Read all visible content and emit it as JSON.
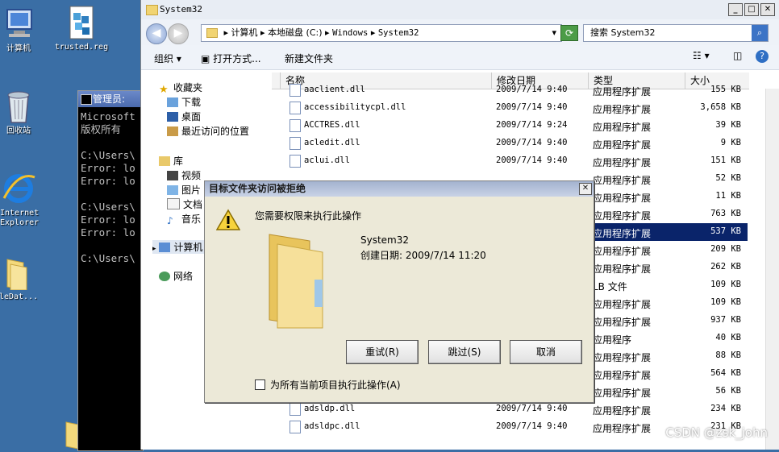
{
  "desktop": {
    "icons": [
      {
        "label": "计算机"
      },
      {
        "label": "trusted.reg"
      },
      {
        "label": "回收站"
      },
      {
        "label": "Internet\nExplorer"
      },
      {
        "label": "acleDat..."
      }
    ]
  },
  "console": {
    "title": "管理员:",
    "lines": "Microsoft\n版权所有\n\nC:\\Users\\\nError: lo\nError: lo\n\nC:\\Users\\\nError: lo\nError: lo\n\nC:\\Users\\"
  },
  "explorer": {
    "title": "System32",
    "address": {
      "parts": [
        "计算机",
        "本地磁盘 (C:)",
        "Windows",
        "System32"
      ],
      "sep": "▸"
    },
    "search_placeholder": "搜索 System32",
    "toolbar": {
      "organize": "组织",
      "open_with": "打开方式...",
      "new_folder": "新建文件夹"
    },
    "nav": {
      "favorites": "收藏夹",
      "downloads": "下载",
      "desktop": "桌面",
      "recent": "最近访问的位置",
      "libraries": "库",
      "videos": "视频",
      "pictures": "图片",
      "documents": "文档",
      "music": "音乐",
      "computer": "计算机",
      "network": "网络"
    },
    "columns": {
      "name": "名称",
      "date": "修改日期",
      "type": "类型",
      "size": "大小"
    },
    "files": [
      {
        "name": "aaclient.dll",
        "date": "2009/7/14 9:40",
        "type": "应用程序扩展",
        "size": "155 KB"
      },
      {
        "name": "accessibilitycpl.dll",
        "date": "2009/7/14 9:40",
        "type": "应用程序扩展",
        "size": "3,658 KB"
      },
      {
        "name": "ACCTRES.dll",
        "date": "2009/7/14 9:24",
        "type": "应用程序扩展",
        "size": "39 KB"
      },
      {
        "name": "acledit.dll",
        "date": "2009/7/14 9:40",
        "type": "应用程序扩展",
        "size": "9 KB"
      },
      {
        "name": "aclui.dll",
        "date": "2009/7/14 9:40",
        "type": "应用程序扩展",
        "size": "151 KB"
      },
      {
        "name": "",
        "date": "",
        "type": "应用程序扩展",
        "size": "52 KB"
      },
      {
        "name": "",
        "date": "",
        "type": "应用程序扩展",
        "size": "11 KB"
      },
      {
        "name": "",
        "date": "",
        "type": "应用程序扩展",
        "size": "763 KB"
      },
      {
        "name": "",
        "date": "",
        "type": "应用程序扩展",
        "size": "537 KB"
      },
      {
        "name": "",
        "date": "",
        "type": "应用程序扩展",
        "size": "209 KB"
      },
      {
        "name": "",
        "date": "",
        "type": "应用程序扩展",
        "size": "262 KB"
      },
      {
        "name": "",
        "date": "",
        "type": "LB 文件",
        "size": "109 KB"
      },
      {
        "name": "",
        "date": "",
        "type": "应用程序扩展",
        "size": "109 KB"
      },
      {
        "name": "",
        "date": "",
        "type": "应用程序扩展",
        "size": "937 KB"
      },
      {
        "name": "",
        "date": "",
        "type": "应用程序",
        "size": "40 KB"
      },
      {
        "name": "",
        "date": "",
        "type": "应用程序扩展",
        "size": "88 KB"
      },
      {
        "name": "",
        "date": "",
        "type": "应用程序扩展",
        "size": "564 KB"
      },
      {
        "name": "",
        "date": "",
        "type": "应用程序扩展",
        "size": "56 KB"
      },
      {
        "name": "adsldp.dll",
        "date": "2009/7/14 9:40",
        "type": "应用程序扩展",
        "size": "234 KB"
      },
      {
        "name": "adsldpc.dll",
        "date": "2009/7/14 9:40",
        "type": "应用程序扩展",
        "size": "231 KB"
      }
    ]
  },
  "dialog": {
    "title": "目标文件夹访问被拒绝",
    "message": "您需要权限来执行此操作",
    "folder_name": "System32",
    "created": "创建日期: 2009/7/14 11:20",
    "retry": "重试(R)",
    "skip": "跳过(S)",
    "cancel": "取消",
    "apply_all": "为所有当前项目执行此操作(A)"
  },
  "watermark": "CSDN @zsk_john",
  "colors": {
    "selection": "#0a246a",
    "desktop": "#3a6ea5"
  }
}
